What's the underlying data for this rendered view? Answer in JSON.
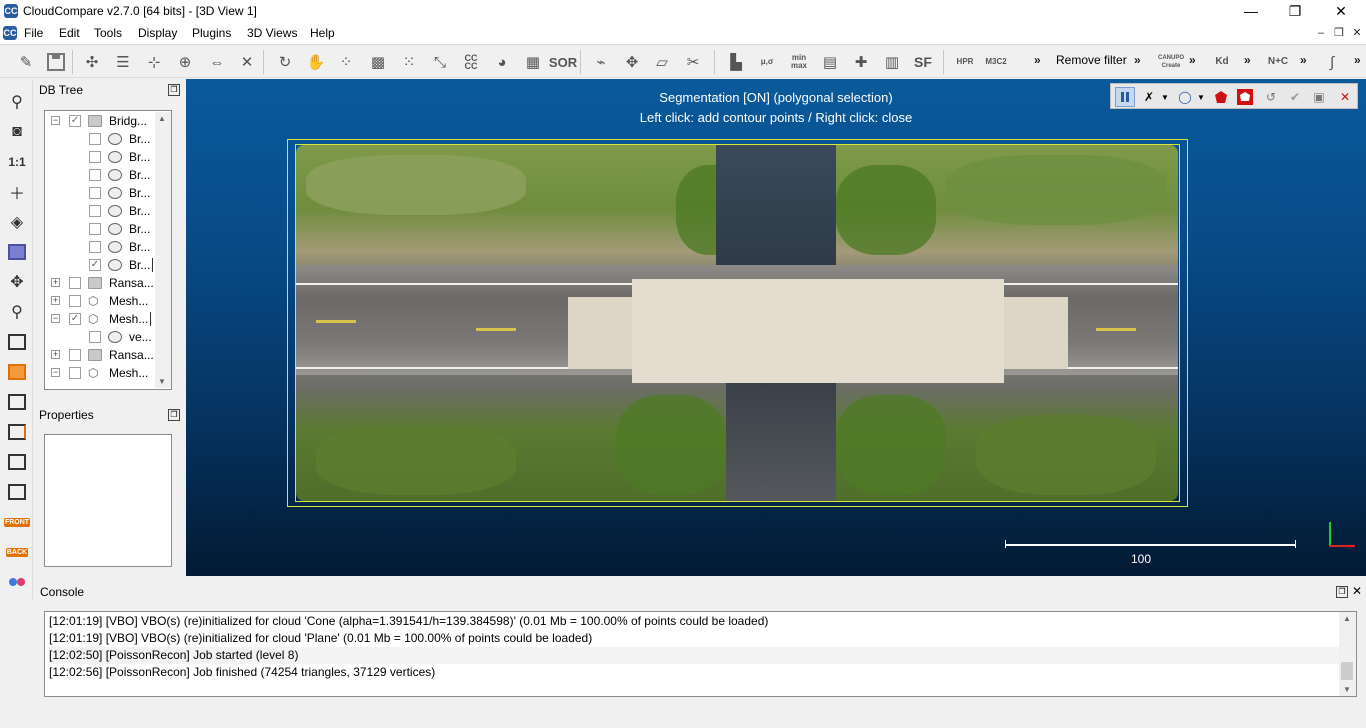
{
  "window": {
    "title": "CloudCompare v2.7.0 [64 bits] - [3D View 1]",
    "logo_text": "CC",
    "minimize": "—",
    "restore": "❐",
    "close": "✕"
  },
  "menu": {
    "items": [
      "File",
      "Edit",
      "Tools",
      "Display",
      "Plugins",
      "3D Views",
      "Help"
    ],
    "mdi_minimize": "–",
    "mdi_restore": "❐",
    "mdi_close": "✕"
  },
  "toolbar": {
    "remove_filter_label": "Remove filter",
    "more": "»",
    "cccc_label": "CC\nCC",
    "sor_label": "SOR",
    "sf_label": "SF",
    "hpr_label": "HPR",
    "m3c2_label": "M3C2",
    "canupo_label": "CANUPO\nCreate",
    "kd_label": "Kd",
    "nc_label": "N+C",
    "minmax_label": "min\nmax",
    "mu_label": "μ,σ"
  },
  "left_toolbar": {
    "one_to_one_label": "1:1",
    "front_label": "FRONT",
    "back_label": "BACK"
  },
  "db_tree": {
    "title": "DB Tree",
    "rows": [
      {
        "label": "Bridg...",
        "expander": "−",
        "checked": true,
        "icon": "folder",
        "indent": 0
      },
      {
        "label": "Br...",
        "expander": "",
        "checked": false,
        "icon": "cloud",
        "indent": 1
      },
      {
        "label": "Br...",
        "expander": "",
        "checked": false,
        "icon": "cloud",
        "indent": 1
      },
      {
        "label": "Br...",
        "expander": "",
        "checked": false,
        "icon": "cloud",
        "indent": 1
      },
      {
        "label": "Br...",
        "expander": "",
        "checked": false,
        "icon": "cloud",
        "indent": 1
      },
      {
        "label": "Br...",
        "expander": "",
        "checked": false,
        "icon": "cloud",
        "indent": 1
      },
      {
        "label": "Br...",
        "expander": "",
        "checked": false,
        "icon": "cloud",
        "indent": 1
      },
      {
        "label": "Br...",
        "expander": "",
        "checked": false,
        "icon": "cloud",
        "indent": 1
      },
      {
        "label": "Br...",
        "expander": "",
        "checked": true,
        "icon": "cloud",
        "indent": 1,
        "selected": true
      },
      {
        "label": "Ransa...",
        "expander": "+",
        "checked": false,
        "icon": "folder",
        "indent": 0
      },
      {
        "label": "Mesh...",
        "expander": "+",
        "checked": false,
        "icon": "mesh",
        "indent": 0
      },
      {
        "label": "Mesh...",
        "expander": "−",
        "checked": true,
        "icon": "mesh",
        "indent": 0,
        "selected": true
      },
      {
        "label": "ve...",
        "expander": "",
        "checked": false,
        "icon": "cloud",
        "indent": 1
      },
      {
        "label": "Ransa...",
        "expander": "+",
        "checked": false,
        "icon": "folder",
        "indent": 0
      },
      {
        "label": "Mesh...",
        "expander": "−",
        "checked": false,
        "icon": "mesh",
        "indent": 0
      }
    ]
  },
  "properties": {
    "title": "Properties"
  },
  "view3d": {
    "segmentation_status": "Segmentation [ON] (polygonal selection)",
    "segmentation_hint": "Left click: add contour points / Right click: close",
    "scale_value": "100"
  },
  "console": {
    "title": "Console",
    "lines": [
      "[12:01:19] [VBO] VBO(s) (re)initialized for cloud 'Cone (alpha=1.391541/h=139.384598)' (0.01 Mb = 100.00% of points could be loaded)",
      "[12:01:19] [VBO] VBO(s) (re)initialized for cloud 'Plane' (0.01 Mb = 100.00% of points could be loaded)",
      "[12:02:50] [PoissonRecon] Job started (level 8)",
      "[12:02:56] [PoissonRecon] Job finished (74254 triangles, 37129 vertices)"
    ]
  },
  "colors": {
    "view_bg_top": "#0a5a9c",
    "view_bg_bottom": "#031a33",
    "bbox": "#d6e63a",
    "axis_x": "#e02020",
    "axis_y": "#1fcc1f"
  }
}
